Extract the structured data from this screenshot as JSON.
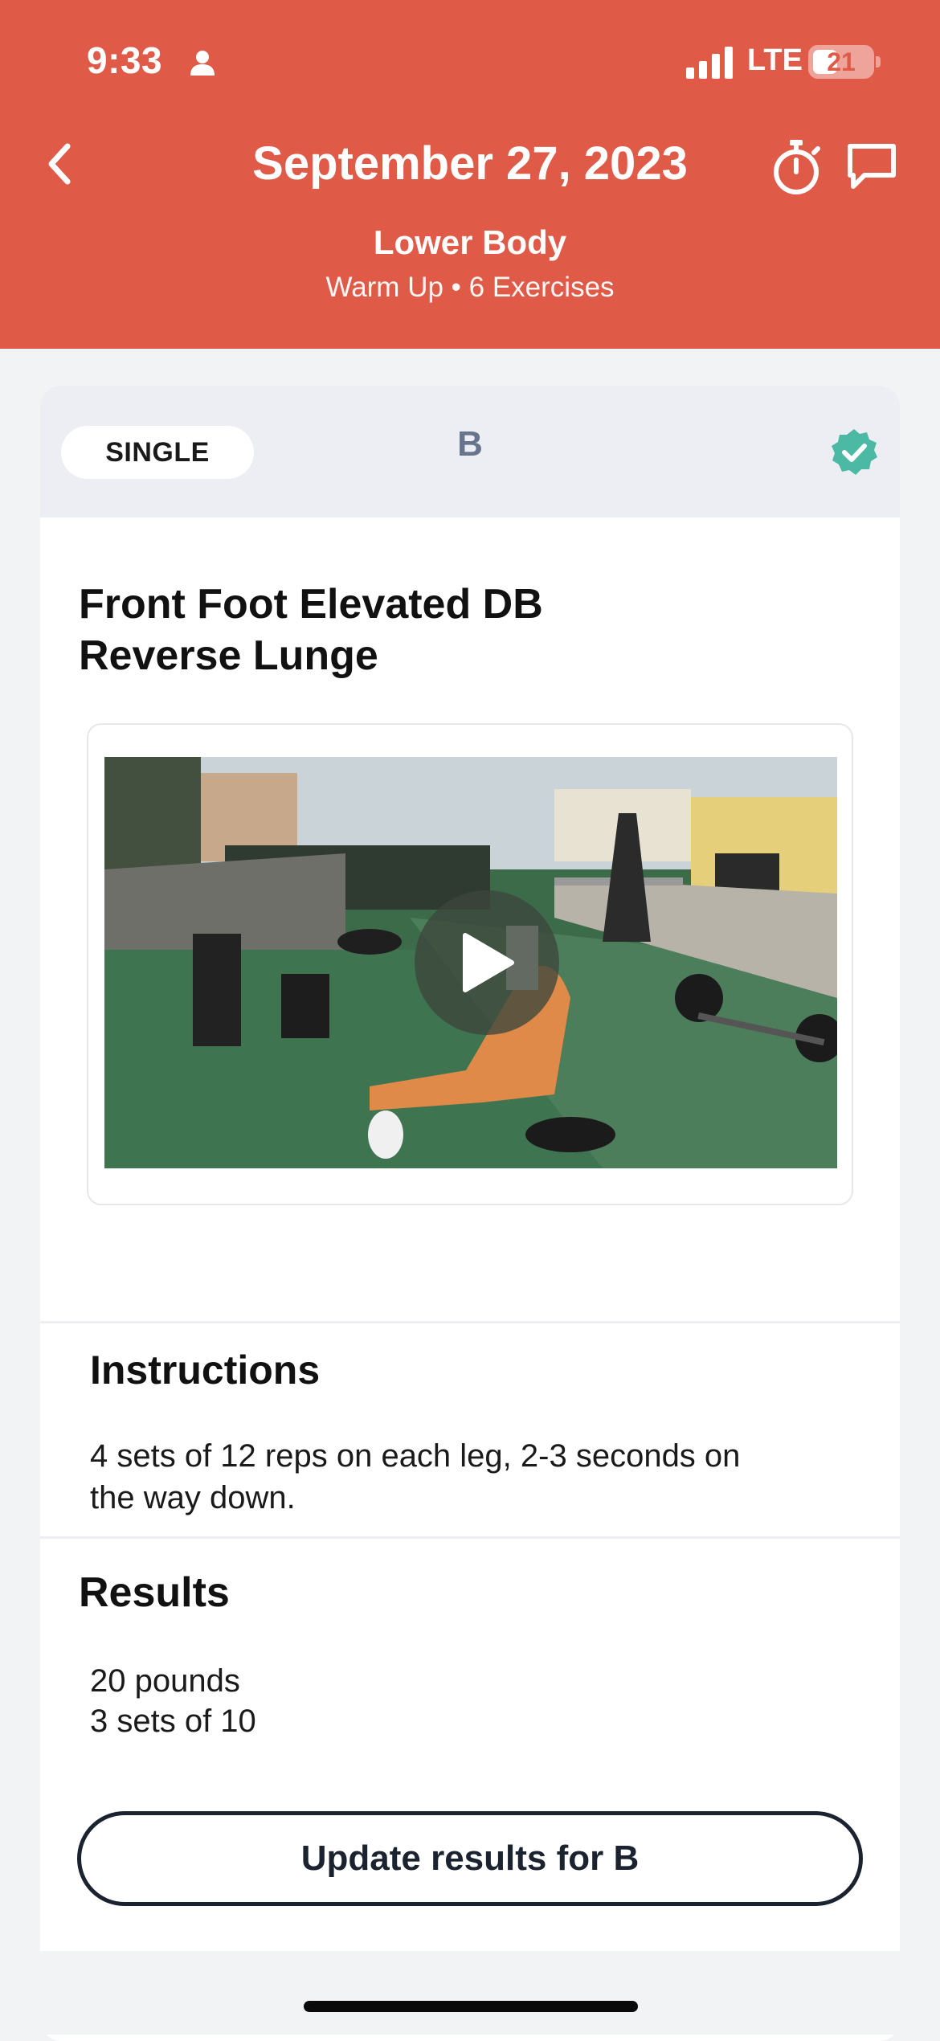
{
  "status_bar": {
    "time": "9:33",
    "network": "LTE",
    "battery_level": "21",
    "icons": [
      "person-icon",
      "signal-bars-icon",
      "battery-icon"
    ]
  },
  "nav": {
    "back_icon": "chevron-left-icon",
    "title": "September 27, 2023",
    "timer_icon": "stopwatch-icon",
    "chat_icon": "chat-bubble-icon"
  },
  "workout": {
    "name": "Lower Body",
    "meta": "Warm Up • 6 Exercises"
  },
  "exercise": {
    "type": "SINGLE",
    "letter": "B",
    "completed_icon": "verified-check-icon",
    "title_line1": "Front Foot Elevated DB",
    "title_line2": "Reverse Lunge",
    "video_play_icon": "play-icon"
  },
  "instructions": {
    "heading": "Instructions",
    "line1": "4 sets of 12 reps on each leg, 2-3 seconds on",
    "line2": "the way down."
  },
  "results": {
    "heading": "Results",
    "lines": [
      "20 pounds",
      "3 sets of 10"
    ]
  },
  "actions": {
    "update_label": "Update results for B"
  },
  "colors": {
    "header": "#e05a48",
    "accent_check": "#4bb9a4",
    "letter": "#66758b",
    "button_border": "#1b2230"
  }
}
